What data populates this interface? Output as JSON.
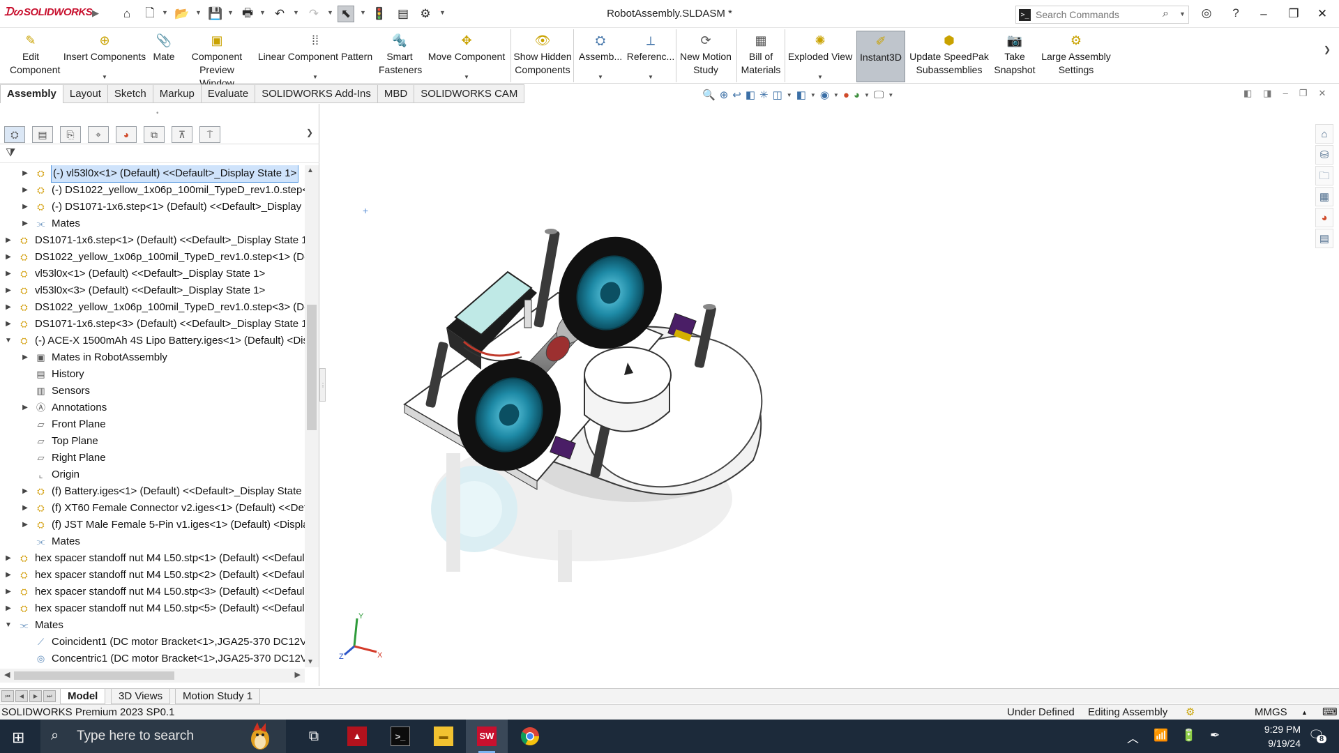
{
  "app": {
    "brand": "SOLIDWORKS",
    "document_title": "RobotAssembly.SLDASM *"
  },
  "search": {
    "placeholder": "Search Commands"
  },
  "ribbon": {
    "buttons": [
      {
        "label": "Edit Component"
      },
      {
        "label": "Insert Components"
      },
      {
        "label": "Mate"
      },
      {
        "label": "Component Preview Window"
      },
      {
        "label": "Linear Component Pattern"
      },
      {
        "label": "Smart Fasteners"
      },
      {
        "label": "Move Component"
      },
      {
        "label": "Show Hidden Components"
      },
      {
        "label": "Assemb..."
      },
      {
        "label": "Referenc..."
      },
      {
        "label": "New Motion Study"
      },
      {
        "label": "Bill of Materials"
      },
      {
        "label": "Exploded View"
      },
      {
        "label": "Instant3D"
      },
      {
        "label": "Update SpeedPak Subassemblies"
      },
      {
        "label": "Take Snapshot"
      },
      {
        "label": "Large Assembly Settings"
      }
    ]
  },
  "cm_tabs": [
    "Assembly",
    "Layout",
    "Sketch",
    "Markup",
    "Evaluate",
    "SOLIDWORKS Add-Ins",
    "MBD",
    "SOLIDWORKS CAM"
  ],
  "tree": {
    "rows": [
      {
        "text": "(-) vl53l0x<1> (Default) <<Default>_Display State 1>",
        "icon": "assembly-icon",
        "selected": true
      },
      {
        "text": "(-) DS1022_yellow_1x06p_100mil_TypeD_rev1.0.step<1:",
        "icon": "assembly-icon"
      },
      {
        "text": "(-) DS1071-1x6.step<1> (Default) <<Default>_Display",
        "icon": "assembly-icon"
      },
      {
        "text": "Mates",
        "icon": "mates-icon"
      },
      {
        "text": "DS1071-1x6.step<1> (Default) <<Default>_Display State 1",
        "icon": "assembly-icon"
      },
      {
        "text": "DS1022_yellow_1x06p_100mil_TypeD_rev1.0.step<1> (Def",
        "icon": "assembly-icon"
      },
      {
        "text": "vl53l0x<1> (Default) <<Default>_Display State 1>",
        "icon": "assembly-icon"
      },
      {
        "text": "vl53l0x<3> (Default) <<Default>_Display State 1>",
        "icon": "assembly-icon"
      },
      {
        "text": "DS1022_yellow_1x06p_100mil_TypeD_rev1.0.step<3> (Def",
        "icon": "assembly-icon"
      },
      {
        "text": "DS1071-1x6.step<3> (Default) <<Default>_Display State 1",
        "icon": "assembly-icon"
      },
      {
        "text": "(-) ACE-X 1500mAh 4S Lipo Battery.iges<1> (Default) <Dis",
        "icon": "assembly-icon"
      },
      {
        "text": "Mates in RobotAssembly",
        "icon": "folder-icon"
      },
      {
        "text": "History",
        "icon": "history-icon"
      },
      {
        "text": "Sensors",
        "icon": "sensors-icon"
      },
      {
        "text": "Annotations",
        "icon": "annotations-icon"
      },
      {
        "text": "Front Plane",
        "icon": "plane-icon"
      },
      {
        "text": "Top Plane",
        "icon": "plane-icon"
      },
      {
        "text": "Right Plane",
        "icon": "plane-icon"
      },
      {
        "text": "Origin",
        "icon": "origin-icon"
      },
      {
        "text": "(f) Battery.iges<1> (Default) <<Default>_Display State",
        "icon": "assembly-icon"
      },
      {
        "text": "(f) XT60 Female Connector v2.iges<1> (Default) <<Def",
        "icon": "assembly-icon"
      },
      {
        "text": "(f) JST Male Female 5-Pin v1.iges<1> (Default) <Displa",
        "icon": "assembly-icon"
      },
      {
        "text": "Mates",
        "icon": "mates-icon"
      },
      {
        "text": "hex spacer standoff nut M4 L50.stp<1> (Default) <<Defaul",
        "icon": "assembly-icon"
      },
      {
        "text": "hex spacer standoff nut M4 L50.stp<2> (Default) <<Defaul",
        "icon": "assembly-icon"
      },
      {
        "text": "hex spacer standoff nut M4 L50.stp<3> (Default) <<Defaul",
        "icon": "assembly-icon"
      },
      {
        "text": "hex spacer standoff nut M4 L50.stp<5> (Default) <<Defaul",
        "icon": "assembly-icon"
      },
      {
        "text": "Mates",
        "icon": "mates-icon"
      },
      {
        "text": "Coincident1 (DC motor Bracket<1>,JGA25-370 DC12V3",
        "icon": "coincident-icon"
      },
      {
        "text": "Concentric1 (DC motor Bracket<1>,JGA25-370 DC12V3",
        "icon": "concentric-icon"
      }
    ]
  },
  "bottom_tabs": [
    "Model",
    "3D Views",
    "Motion Study 1"
  ],
  "status": {
    "product": "SOLIDWORKS Premium 2023 SP0.1",
    "state": "Under Defined",
    "mode": "Editing Assembly",
    "units": "MMGS"
  },
  "taskbar": {
    "search_placeholder": "Type here to search",
    "time": "9:29 PM",
    "date": "9/19/24",
    "notifications": "8",
    "sw_badge": "SW"
  },
  "triad": {
    "x": "X",
    "y": "Y",
    "z": "Z"
  },
  "colors": {
    "brand_red": "#c8102e",
    "selection": "#cfe3fb",
    "wheel_hub": "#1e8aa6",
    "taskbar": "#1c2a3a"
  }
}
